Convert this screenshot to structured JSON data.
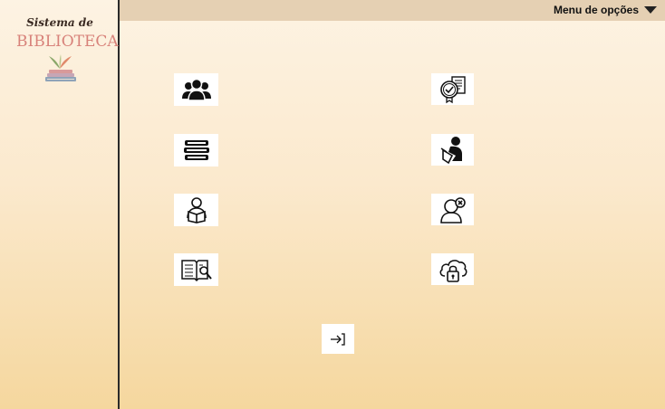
{
  "sidebar": {
    "logo": {
      "line1": "Sistema de",
      "line2": "BIBLIOTECA"
    }
  },
  "topbar": {
    "menu_label": "Menu de opções",
    "menu_icon": "caret-down-icon"
  },
  "menu": {
    "left": [
      {
        "icon": "users-group-icon"
      },
      {
        "icon": "book-stack-icon"
      },
      {
        "icon": "reader-with-book-icon"
      },
      {
        "icon": "book-search-icon"
      }
    ],
    "right": [
      {
        "icon": "approved-document-icon"
      },
      {
        "icon": "person-reading-icon"
      },
      {
        "icon": "remove-user-icon"
      },
      {
        "icon": "cloud-lock-icon"
      }
    ],
    "exit_icon": "logout-icon"
  },
  "colors": {
    "background_top": "#fdf3e3",
    "background_bottom": "#f5d79e",
    "topbar": "#e5d0b3",
    "logo_text": "#d8827a",
    "sidebar_border": "#2a2a2a"
  }
}
